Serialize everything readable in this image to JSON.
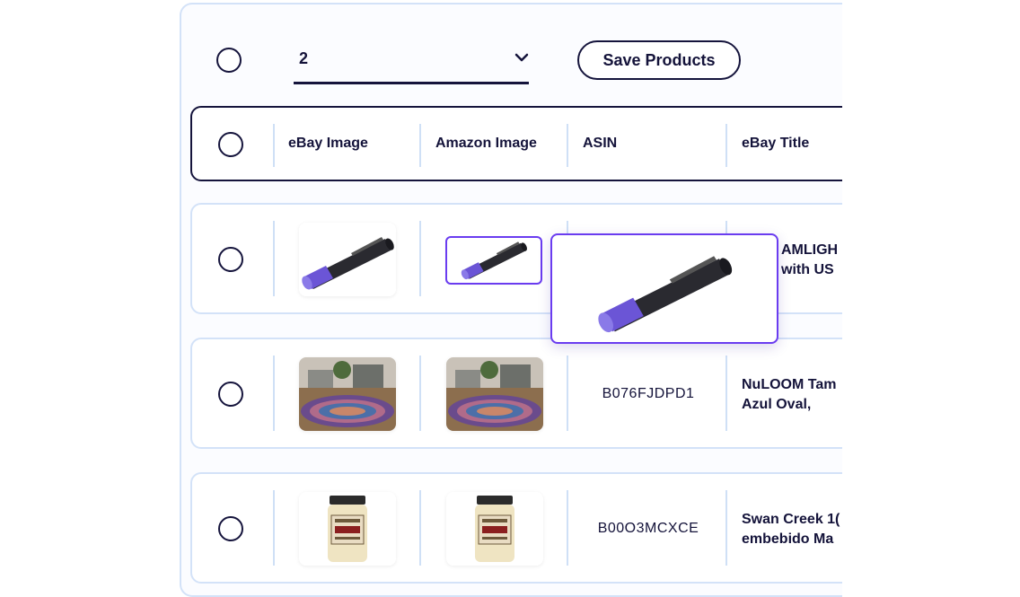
{
  "toolbar": {
    "page_select_value": "2",
    "save_label": "Save Products"
  },
  "table": {
    "columns": [
      "eBay Image",
      "Amazon Image",
      "ASIN",
      "eBay Title"
    ],
    "rows": [
      {
        "asin": "",
        "title_lines": [
          "AMLIGH",
          "with US"
        ],
        "product": "penlight"
      },
      {
        "asin": "B076FJDPD1",
        "title_lines": [
          "NuLOOM Tam",
          "Azul Oval,"
        ],
        "product": "oval rug"
      },
      {
        "asin": "B00O3MCXCE",
        "title_lines": [
          "Swan Creek 1(",
          "embebido Ma"
        ],
        "product": "candle jar"
      }
    ]
  },
  "colors": {
    "accent": "#6a3cf0",
    "ink": "#15143c",
    "border": "#d3e2f8",
    "flashlight_tip": "#6b55d6"
  }
}
